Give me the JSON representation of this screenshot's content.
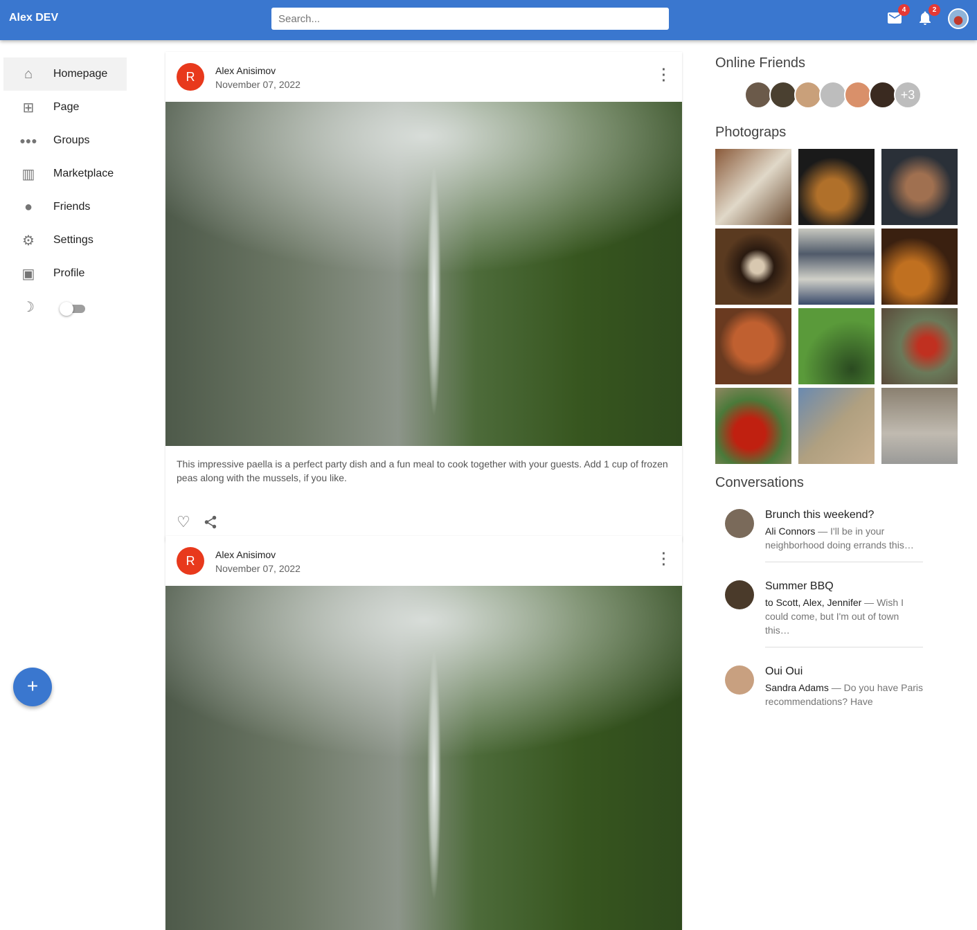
{
  "app": {
    "title": "Alex DEV",
    "search_placeholder": "Search...",
    "mail_count": "4",
    "notif_count": "2"
  },
  "nav": [
    {
      "label": "Homepage",
      "icon": "home-icon"
    },
    {
      "label": "Page",
      "icon": "page-icon"
    },
    {
      "label": "Groups",
      "icon": "groups-icon"
    },
    {
      "label": "Marketplace",
      "icon": "store-icon"
    },
    {
      "label": "Friends",
      "icon": "person-icon"
    },
    {
      "label": "Settings",
      "icon": "gear-icon"
    },
    {
      "label": "Profile",
      "icon": "profile-icon"
    }
  ],
  "fab_label": "+",
  "posts": [
    {
      "avatar": "R",
      "author": "Alex Anisimov",
      "date": "November 07, 2022",
      "text": "This impressive paella is a perfect party dish and a fun meal to cook together with your guests. Add 1 cup of frozen peas along with the mussels, if you like."
    },
    {
      "avatar": "R",
      "author": "Alex Anisimov",
      "date": "November 07, 2022"
    }
  ],
  "online_friends": {
    "title": "Online Friends",
    "more": "+3"
  },
  "photos": {
    "title": "Photograps"
  },
  "conversations": {
    "title": "Conversations",
    "items": [
      {
        "title": "Brunch this weekend?",
        "who": "Ali Connors",
        "text": " — I'll be in your neighborhood doing errands this…"
      },
      {
        "title": "Summer BBQ",
        "who": "to Scott, Alex, Jennifer",
        "text": " — Wish I could come, but I'm out of town this…"
      },
      {
        "title": "Oui Oui",
        "who": "Sandra Adams",
        "text": " — Do you have Paris recommendations? Have"
      }
    ]
  }
}
